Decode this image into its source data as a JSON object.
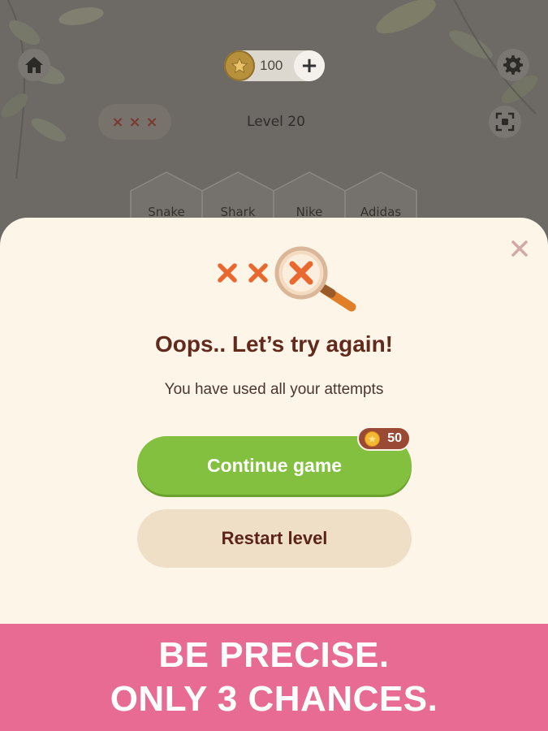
{
  "header": {
    "coins": "100",
    "add_label": "+",
    "level_title": "Level 20",
    "lives_marks": [
      "×",
      "×",
      "×"
    ]
  },
  "categories": [
    "Snake",
    "Shark",
    "Nike",
    "Adidas"
  ],
  "modal": {
    "title": "Oops.. Let’s try again!",
    "subtitle": "You have used all your attempts",
    "continue_label": "Continue game",
    "continue_cost": "50",
    "restart_label": "Restart level",
    "close_label": "×"
  },
  "promo": {
    "line1": "BE PRECISE.",
    "line2": "ONLY 3 CHANCES."
  },
  "icons": {
    "home": "home-icon",
    "settings": "gear-icon",
    "focus": "focus-frame-icon",
    "close": "close-icon",
    "magnifier": "magnifier-icon",
    "coin": "star-coin-icon"
  },
  "colors": {
    "modal_bg": "#fcf5e8",
    "continue_green": "#83c03f",
    "restart_beige": "#efdfc6",
    "title_brown": "#62291d",
    "cross_orange": "#e8682f",
    "promo_pink": "#e86b93",
    "cost_badge": "#9a4a34"
  }
}
